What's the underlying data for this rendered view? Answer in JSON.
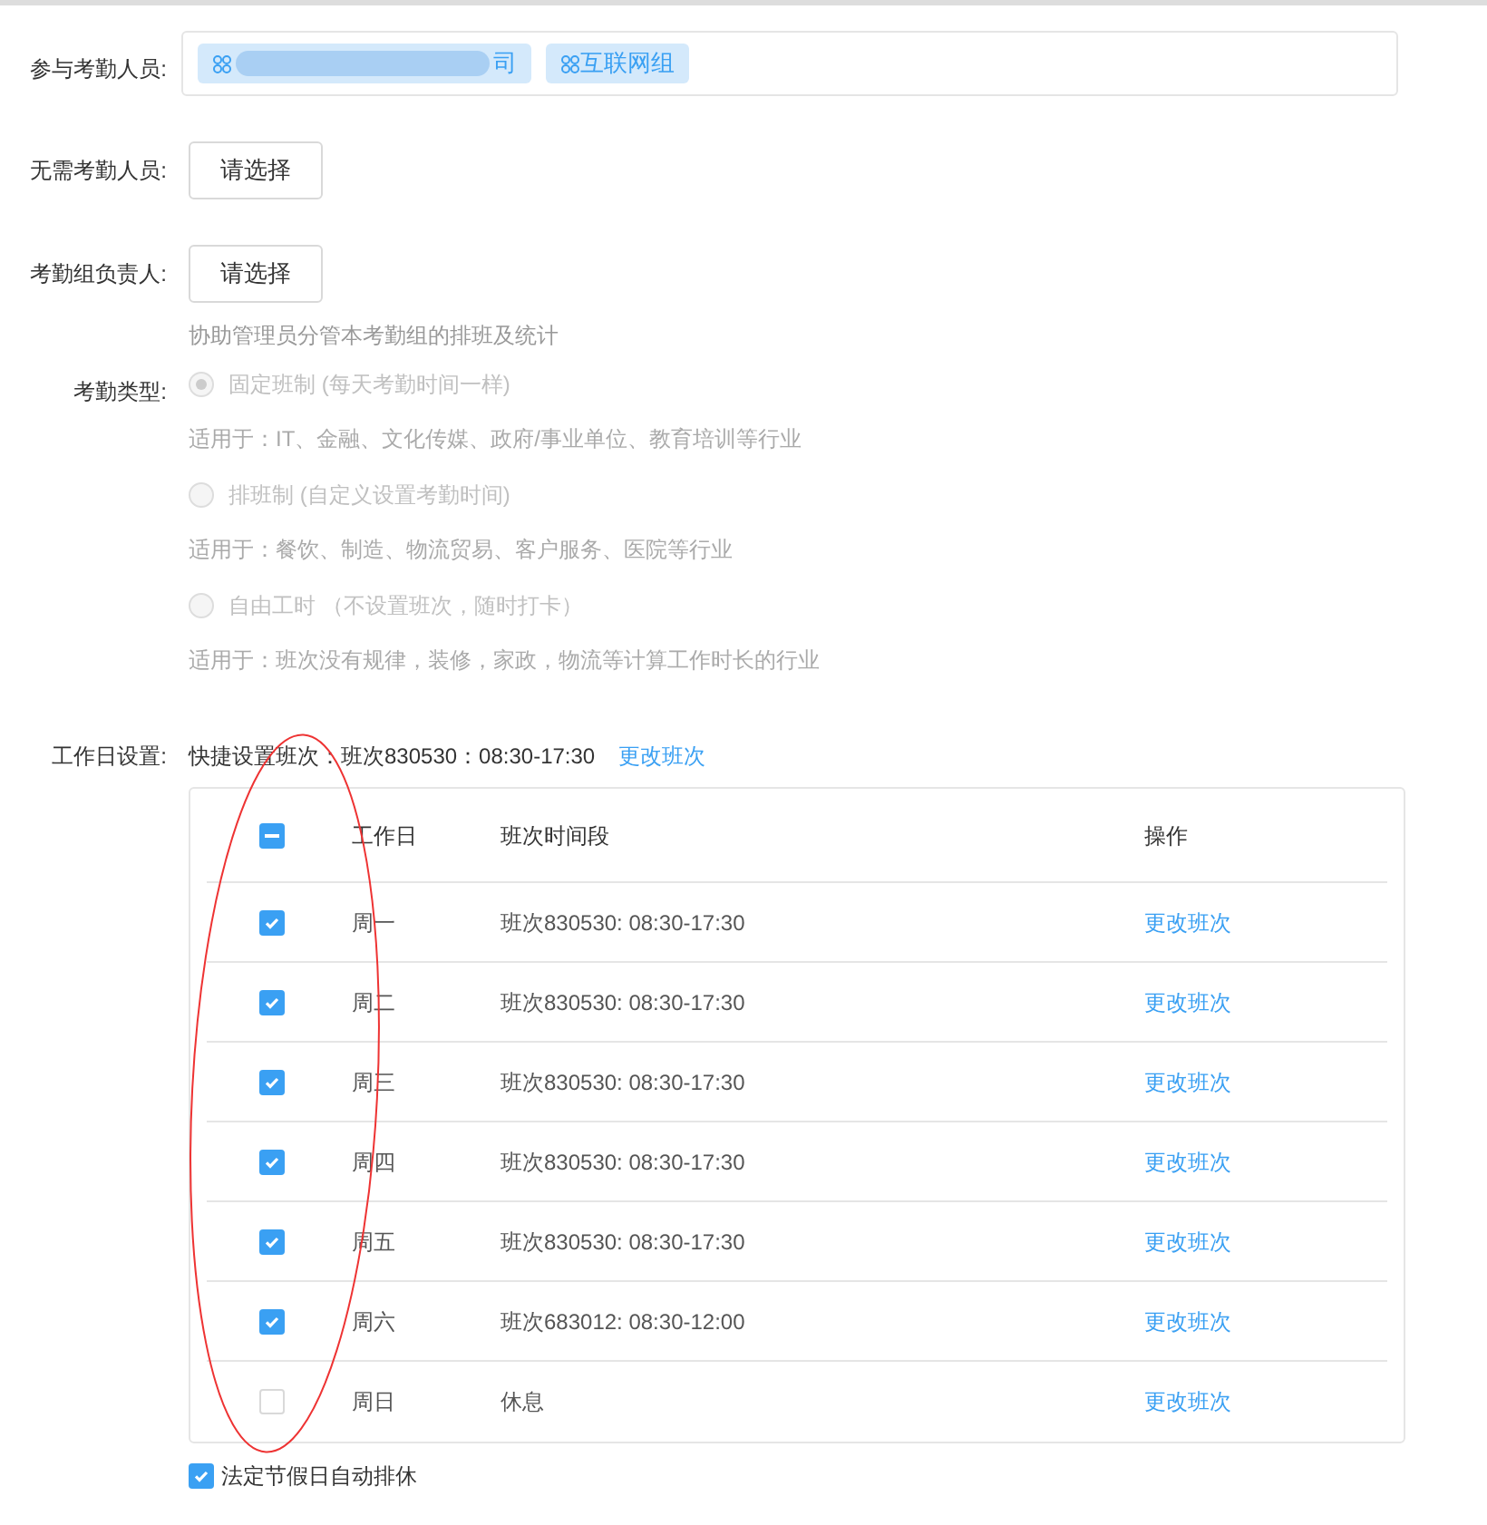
{
  "members": {
    "label": "参与考勤人员:",
    "tags": [
      {
        "kind": "redacted",
        "text": "司"
      },
      {
        "kind": "plain",
        "text": "互联网组"
      }
    ]
  },
  "exempt": {
    "label": "无需考勤人员:",
    "button": "请选择"
  },
  "manager": {
    "label": "考勤组负责人:",
    "button": "请选择",
    "hint": "协助管理员分管本考勤组的排班及统计"
  },
  "attendance_type": {
    "label": "考勤类型:",
    "disabled": true,
    "options": [
      {
        "title": "固定班制",
        "note": "(每天考勤时间一样)",
        "desc": "适用于：IT、金融、文化传媒、政府/事业单位、教育培训等行业",
        "selected": true
      },
      {
        "title": "排班制",
        "note": "(自定义设置考勤时间)",
        "desc": "适用于：餐饮、制造、物流贸易、客户服务、医院等行业",
        "selected": false
      },
      {
        "title": "自由工时",
        "note": "（不设置班次，随时打卡）",
        "desc": "适用于：班次没有规律，装修，家政，物流等计算工作时长的行业",
        "selected": false
      }
    ]
  },
  "workdays": {
    "label": "工作日设置:",
    "quick": "快捷设置班次：班次830530：08:30-17:30",
    "quick_link": "更改班次",
    "columns": [
      "工作日",
      "班次时间段",
      "操作"
    ],
    "header_checked": true,
    "header_indeterminate": true,
    "rows": [
      {
        "day": "周一",
        "shift": "班次830530: 08:30-17:30",
        "action": "更改班次",
        "checked": true
      },
      {
        "day": "周二",
        "shift": "班次830530: 08:30-17:30",
        "action": "更改班次",
        "checked": true
      },
      {
        "day": "周三",
        "shift": "班次830530: 08:30-17:30",
        "action": "更改班次",
        "checked": true
      },
      {
        "day": "周四",
        "shift": "班次830530: 08:30-17:30",
        "action": "更改班次",
        "checked": true
      },
      {
        "day": "周五",
        "shift": "班次830530: 08:30-17:30",
        "action": "更改班次",
        "checked": true
      },
      {
        "day": "周六",
        "shift": "班次683012: 08:30-12:00",
        "action": "更改班次",
        "checked": true
      },
      {
        "day": "周日",
        "shift": "休息",
        "action": "更改班次",
        "checked": false
      }
    ],
    "holiday": {
      "label": "法定节假日自动排休",
      "checked": true
    }
  }
}
